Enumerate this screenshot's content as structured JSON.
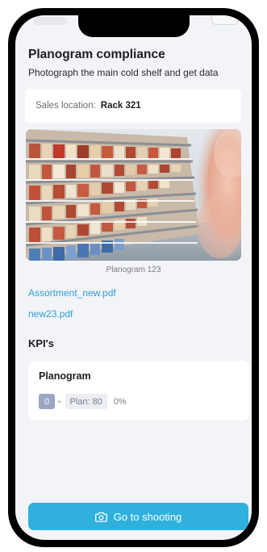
{
  "header": {
    "title": "Planogram compliance",
    "subtitle": "Photograph the main cold shelf and get data"
  },
  "location": {
    "label": "Sales location:",
    "value": "Rack 321"
  },
  "photo": {
    "caption": "Planogram 123"
  },
  "files": [
    {
      "name": "Assortment_new.pdf"
    },
    {
      "name": "new23.pdf"
    }
  ],
  "kpi": {
    "heading": "KPI's",
    "card": {
      "title": "Planogram",
      "count": "0",
      "plan": "Plan: 80",
      "percent": "0%"
    }
  },
  "action": {
    "label": "Go to shooting",
    "icon": "camera-icon"
  },
  "colors": {
    "accent": "#2fb0dd",
    "link": "#2e9ed6",
    "background": "#f3f4f8"
  }
}
